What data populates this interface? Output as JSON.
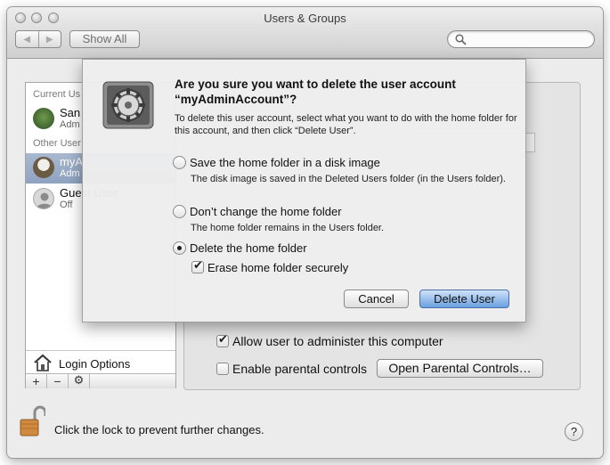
{
  "window": {
    "title": "Users & Groups",
    "show_all_label": "Show All",
    "search_placeholder": ""
  },
  "sidebar": {
    "current_users_header": "Current Us",
    "other_users_header": "Other User",
    "users": [
      {
        "name": "San",
        "role": "Adm"
      },
      {
        "name": "myA",
        "role": "Adm"
      },
      {
        "name": "Guest User",
        "role": "Off"
      }
    ],
    "login_options_label": "Login Options",
    "controls": [
      "+",
      "−",
      "⚙"
    ]
  },
  "main": {
    "allow_admin_label": "Allow user to administer this computer",
    "allow_admin_checked": true,
    "parental_label": "Enable parental controls",
    "parental_checked": false,
    "open_parental_button": "Open Parental Controls…"
  },
  "footer": {
    "lock_text": "Click the lock to prevent further changes.",
    "help_label": "?"
  },
  "dialog": {
    "title": "Are you sure you want to delete the user account “myAdminAccount”?",
    "description": "To delete this user account, select what you want to do with the home folder for this account, and then click “Delete User”.",
    "options": [
      {
        "label": "Save the home folder in a disk image",
        "sub": "The disk image is saved in the Deleted Users folder (in the Users folder).",
        "selected": false
      },
      {
        "label": "Don’t change the home folder",
        "sub": "The home folder remains in the Users folder.",
        "selected": false
      },
      {
        "label": "Delete the home folder",
        "sub": "",
        "selected": true
      }
    ],
    "erase_label": "Erase home folder securely",
    "erase_checked": true,
    "cancel_label": "Cancel",
    "delete_label": "Delete User"
  }
}
